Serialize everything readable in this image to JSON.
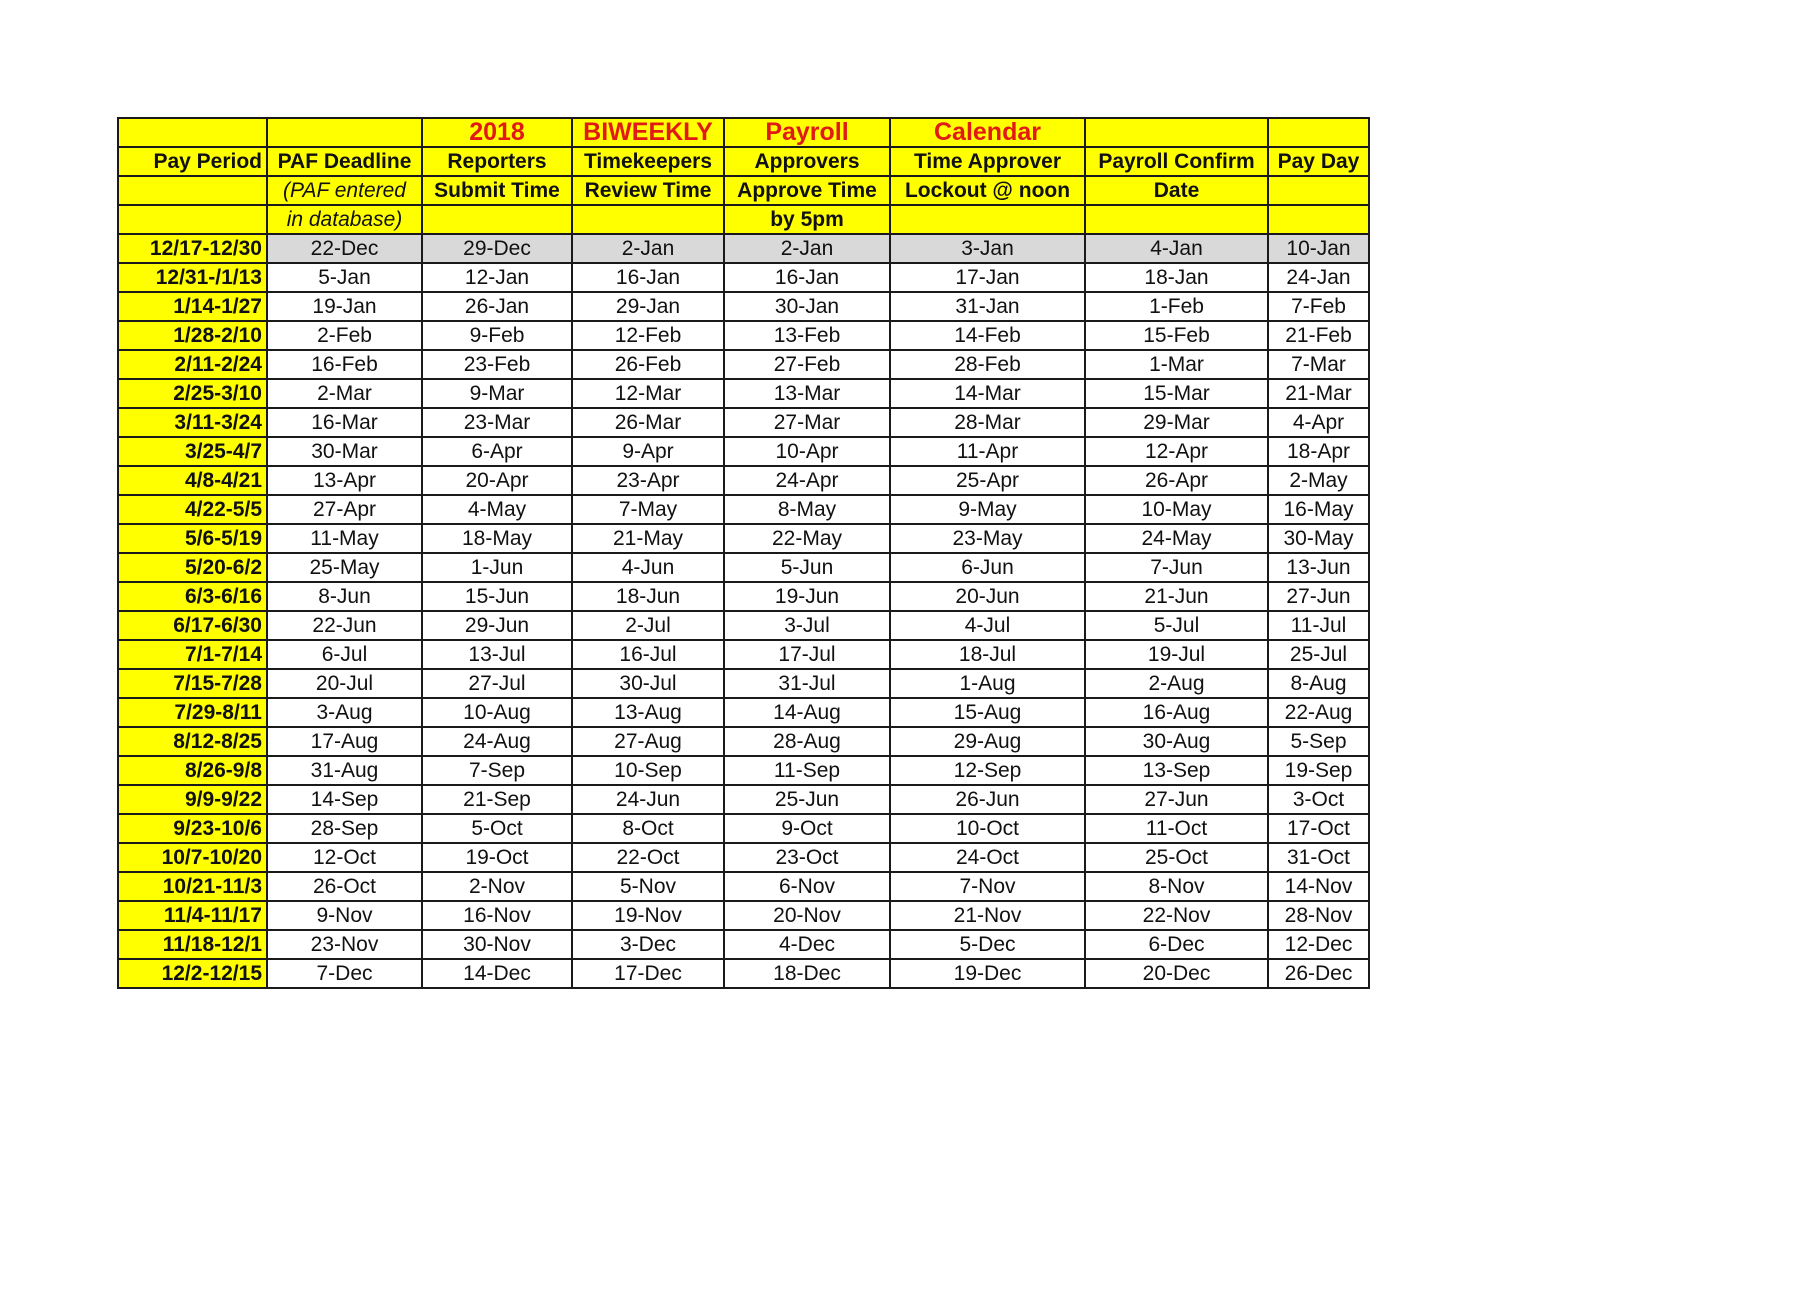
{
  "title_row": [
    "",
    "",
    "2018",
    "BIWEEKLY",
    "Payroll",
    "Calendar",
    "",
    ""
  ],
  "header_rows": [
    [
      "Pay Period",
      "PAF Deadline",
      "Reporters",
      "Timekeepers",
      "Approvers",
      "Time Approver",
      "Payroll Confirm",
      "Pay Day"
    ],
    [
      "",
      "(PAF entered",
      "Submit Time",
      "Review Time",
      "Approve Time",
      "Lockout @ noon",
      "Date",
      ""
    ],
    [
      "",
      "in database)",
      "",
      "",
      "by 5pm",
      "",
      "",
      ""
    ]
  ],
  "colors": {
    "header_bg": "#ffff00",
    "title_text": "#e01a14",
    "shaded_row": "#d9d9d9",
    "border": "#1a1a1a"
  },
  "rows": [
    {
      "period": "12/17-12/30",
      "shaded": true,
      "values": [
        "22-Dec",
        "29-Dec",
        "2-Jan",
        "2-Jan",
        "3-Jan",
        "4-Jan",
        "10-Jan"
      ]
    },
    {
      "period": "12/31-/1/13",
      "values": [
        "5-Jan",
        "12-Jan",
        "16-Jan",
        "16-Jan",
        "17-Jan",
        "18-Jan",
        "24-Jan"
      ]
    },
    {
      "period": "1/14-1/27",
      "values": [
        "19-Jan",
        "26-Jan",
        "29-Jan",
        "30-Jan",
        "31-Jan",
        "1-Feb",
        "7-Feb"
      ]
    },
    {
      "period": "1/28-2/10",
      "values": [
        "2-Feb",
        "9-Feb",
        "12-Feb",
        "13-Feb",
        "14-Feb",
        "15-Feb",
        "21-Feb"
      ]
    },
    {
      "period": "2/11-2/24",
      "values": [
        "16-Feb",
        "23-Feb",
        "26-Feb",
        "27-Feb",
        "28-Feb",
        "1-Mar",
        "7-Mar"
      ]
    },
    {
      "period": "2/25-3/10",
      "values": [
        "2-Mar",
        "9-Mar",
        "12-Mar",
        "13-Mar",
        "14-Mar",
        "15-Mar",
        "21-Mar"
      ]
    },
    {
      "period": "3/11-3/24",
      "values": [
        "16-Mar",
        "23-Mar",
        "26-Mar",
        "27-Mar",
        "28-Mar",
        "29-Mar",
        "4-Apr"
      ]
    },
    {
      "period": "3/25-4/7",
      "values": [
        "30-Mar",
        "6-Apr",
        "9-Apr",
        "10-Apr",
        "11-Apr",
        "12-Apr",
        "18-Apr"
      ]
    },
    {
      "period": "4/8-4/21",
      "values": [
        "13-Apr",
        "20-Apr",
        "23-Apr",
        "24-Apr",
        "25-Apr",
        "26-Apr",
        "2-May"
      ]
    },
    {
      "period": "4/22-5/5",
      "values": [
        "27-Apr",
        "4-May",
        "7-May",
        "8-May",
        "9-May",
        "10-May",
        "16-May"
      ]
    },
    {
      "period": "5/6-5/19",
      "values": [
        "11-May",
        "18-May",
        "21-May",
        "22-May",
        "23-May",
        "24-May",
        "30-May"
      ]
    },
    {
      "period": "5/20-6/2",
      "values": [
        "25-May",
        "1-Jun",
        "4-Jun",
        "5-Jun",
        "6-Jun",
        "7-Jun",
        "13-Jun"
      ]
    },
    {
      "period": "6/3-6/16",
      "values": [
        "8-Jun",
        "15-Jun",
        "18-Jun",
        "19-Jun",
        "20-Jun",
        "21-Jun",
        "27-Jun"
      ]
    },
    {
      "period": "6/17-6/30",
      "values": [
        "22-Jun",
        "29-Jun",
        "2-Jul",
        "3-Jul",
        "4-Jul",
        "5-Jul",
        "11-Jul"
      ]
    },
    {
      "period": "7/1-7/14",
      "values": [
        "6-Jul",
        "13-Jul",
        "16-Jul",
        "17-Jul",
        "18-Jul",
        "19-Jul",
        "25-Jul"
      ]
    },
    {
      "period": "7/15-7/28",
      "values": [
        "20-Jul",
        "27-Jul",
        "30-Jul",
        "31-Jul",
        "1-Aug",
        "2-Aug",
        "8-Aug"
      ]
    },
    {
      "period": "7/29-8/11",
      "values": [
        "3-Aug",
        "10-Aug",
        "13-Aug",
        "14-Aug",
        "15-Aug",
        "16-Aug",
        "22-Aug"
      ]
    },
    {
      "period": "8/12-8/25",
      "values": [
        "17-Aug",
        "24-Aug",
        "27-Aug",
        "28-Aug",
        "29-Aug",
        "30-Aug",
        "5-Sep"
      ]
    },
    {
      "period": "8/26-9/8",
      "values": [
        "31-Aug",
        "7-Sep",
        "10-Sep",
        "11-Sep",
        "12-Sep",
        "13-Sep",
        "19-Sep"
      ]
    },
    {
      "period": "9/9-9/22",
      "values": [
        "14-Sep",
        "21-Sep",
        "24-Jun",
        "25-Jun",
        "26-Jun",
        "27-Jun",
        "3-Oct"
      ]
    },
    {
      "period": "9/23-10/6",
      "values": [
        "28-Sep",
        "5-Oct",
        "8-Oct",
        "9-Oct",
        "10-Oct",
        "11-Oct",
        "17-Oct"
      ]
    },
    {
      "period": "10/7-10/20",
      "values": [
        "12-Oct",
        "19-Oct",
        "22-Oct",
        "23-Oct",
        "24-Oct",
        "25-Oct",
        "31-Oct"
      ]
    },
    {
      "period": "10/21-11/3",
      "values": [
        "26-Oct",
        "2-Nov",
        "5-Nov",
        "6-Nov",
        "7-Nov",
        "8-Nov",
        "14-Nov"
      ]
    },
    {
      "period": "11/4-11/17",
      "values": [
        "9-Nov",
        "16-Nov",
        "19-Nov",
        "20-Nov",
        "21-Nov",
        "22-Nov",
        "28-Nov"
      ]
    },
    {
      "period": "11/18-12/1",
      "values": [
        "23-Nov",
        "30-Nov",
        "3-Dec",
        "4-Dec",
        "5-Dec",
        "6-Dec",
        "12-Dec"
      ]
    },
    {
      "period": "12/2-12/15",
      "values": [
        "7-Dec",
        "14-Dec",
        "17-Dec",
        "18-Dec",
        "19-Dec",
        "20-Dec",
        "26-Dec"
      ]
    }
  ]
}
